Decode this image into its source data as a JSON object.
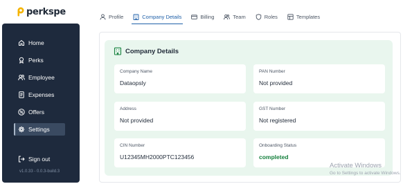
{
  "brand": {
    "name": "perkspe",
    "logo_color": "#f5b400"
  },
  "sidebar": {
    "items": [
      {
        "label": "Home",
        "icon": "home-icon"
      },
      {
        "label": "Perks",
        "icon": "award-icon"
      },
      {
        "label": "Employee",
        "icon": "users-icon"
      },
      {
        "label": "Expenses",
        "icon": "receipt-icon"
      },
      {
        "label": "Offers",
        "icon": "percent-icon"
      },
      {
        "label": "Settings",
        "icon": "gear-icon",
        "active": true
      }
    ],
    "signout_label": "Sign out",
    "version": "v1.0.33 - 0.0.3-build.3"
  },
  "tabs": [
    {
      "label": "Profile",
      "icon": "user-icon"
    },
    {
      "label": "Company Details",
      "icon": "building-icon",
      "active": true
    },
    {
      "label": "Billing",
      "icon": "card-icon"
    },
    {
      "label": "Team",
      "icon": "team-icon"
    },
    {
      "label": "Roles",
      "icon": "shield-icon"
    },
    {
      "label": "Templates",
      "icon": "template-icon"
    }
  ],
  "company": {
    "title": "Company Details",
    "fields": [
      {
        "label": "Company Name",
        "value": "Dataopsly"
      },
      {
        "label": "PAN Number",
        "value": "Not provided"
      },
      {
        "label": "Address",
        "value": "Not provided"
      },
      {
        "label": "GST Number",
        "value": "Not registered"
      },
      {
        "label": "CIN Number",
        "value": "U12345MH2000PTC123456"
      },
      {
        "label": "Onboarding Status",
        "value": "completed"
      }
    ]
  },
  "watermark": {
    "title": "Activate Windows",
    "subtitle": "Go to Settings to activate Windows."
  },
  "colors": {
    "nav_bg": "#1e2a3d",
    "accent": "#1e5fa8",
    "panel_bg": "#e9f6ee",
    "success": "#15803d"
  }
}
